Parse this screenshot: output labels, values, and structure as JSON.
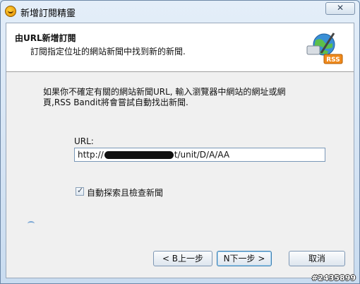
{
  "window": {
    "title": "新增訂閱精靈",
    "close_label": "✕"
  },
  "header": {
    "title": "由URL新增訂閱",
    "subtitle": "訂閱指定位址的網站新聞中找到新的新聞.",
    "logo_text": "RSS"
  },
  "body": {
    "instructions": "如果你不確定有關的網站新聞URL, 輸入瀏覽器中網站的網址或網頁,RSS Bandit將會嘗試自動找出新聞.",
    "url_label": "URL:",
    "url_value_prefix": "http://",
    "url_value_suffix": "t/unit/D/A/AA",
    "auto_detect_label": "自動探索且檢查新聞",
    "auto_detect_checked": true
  },
  "buttons": {
    "back": "< B上一步",
    "next": "N下一步 >",
    "cancel": "取消"
  },
  "watermark": "#2435899"
}
